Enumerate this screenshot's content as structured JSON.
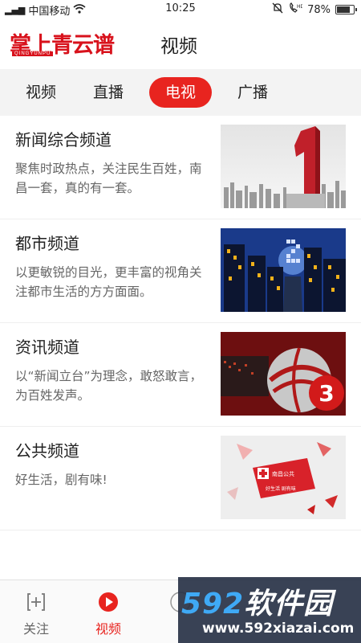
{
  "status_bar": {
    "carrier": "中国移动",
    "time": "10:25",
    "battery_percent": "78%",
    "battery_level": 0.78
  },
  "header": {
    "logo_text": "掌上青云谱",
    "logo_subtext": "QINGYUNPU",
    "title": "视频"
  },
  "tabs": [
    {
      "label": "视频",
      "active": false
    },
    {
      "label": "直播",
      "active": false
    },
    {
      "label": "电视",
      "active": true
    },
    {
      "label": "广播",
      "active": false
    }
  ],
  "channels": [
    {
      "title": "新闻综合频道",
      "desc": "聚焦时政热点，关注民生百姓，南昌一套，真的有一套。"
    },
    {
      "title": "都市频道",
      "desc": "以更敏锐的目光，更丰富的视角关注都市生活的方方面面。"
    },
    {
      "title": "资讯频道",
      "desc": "以“新闻立台”为理念，敢怒敢言，为百姓发声。"
    },
    {
      "title": "公共频道",
      "desc": "好生活，剧有味!"
    }
  ],
  "bottom_nav": [
    {
      "label": "关注",
      "icon": "plus-box-icon",
      "active": false
    },
    {
      "label": "视频",
      "icon": "play-circle-icon",
      "active": true
    },
    {
      "label": "",
      "icon": "city-icon",
      "active": false
    },
    {
      "label": "",
      "icon": "user-icon",
      "active": false
    }
  ],
  "thumbnails": {
    "thumb_3_number": "3",
    "thumb_4_caption": "好生活 剧有味",
    "thumb_4_sign": "南昌公共"
  },
  "watermark": {
    "brand_digits": "592",
    "brand_text": "软件园",
    "url": "www.592xiazai.com"
  },
  "colors": {
    "accent": "#e8241f",
    "logo_red": "#d8121c",
    "tab_bar_bg": "#f3f3f3"
  }
}
